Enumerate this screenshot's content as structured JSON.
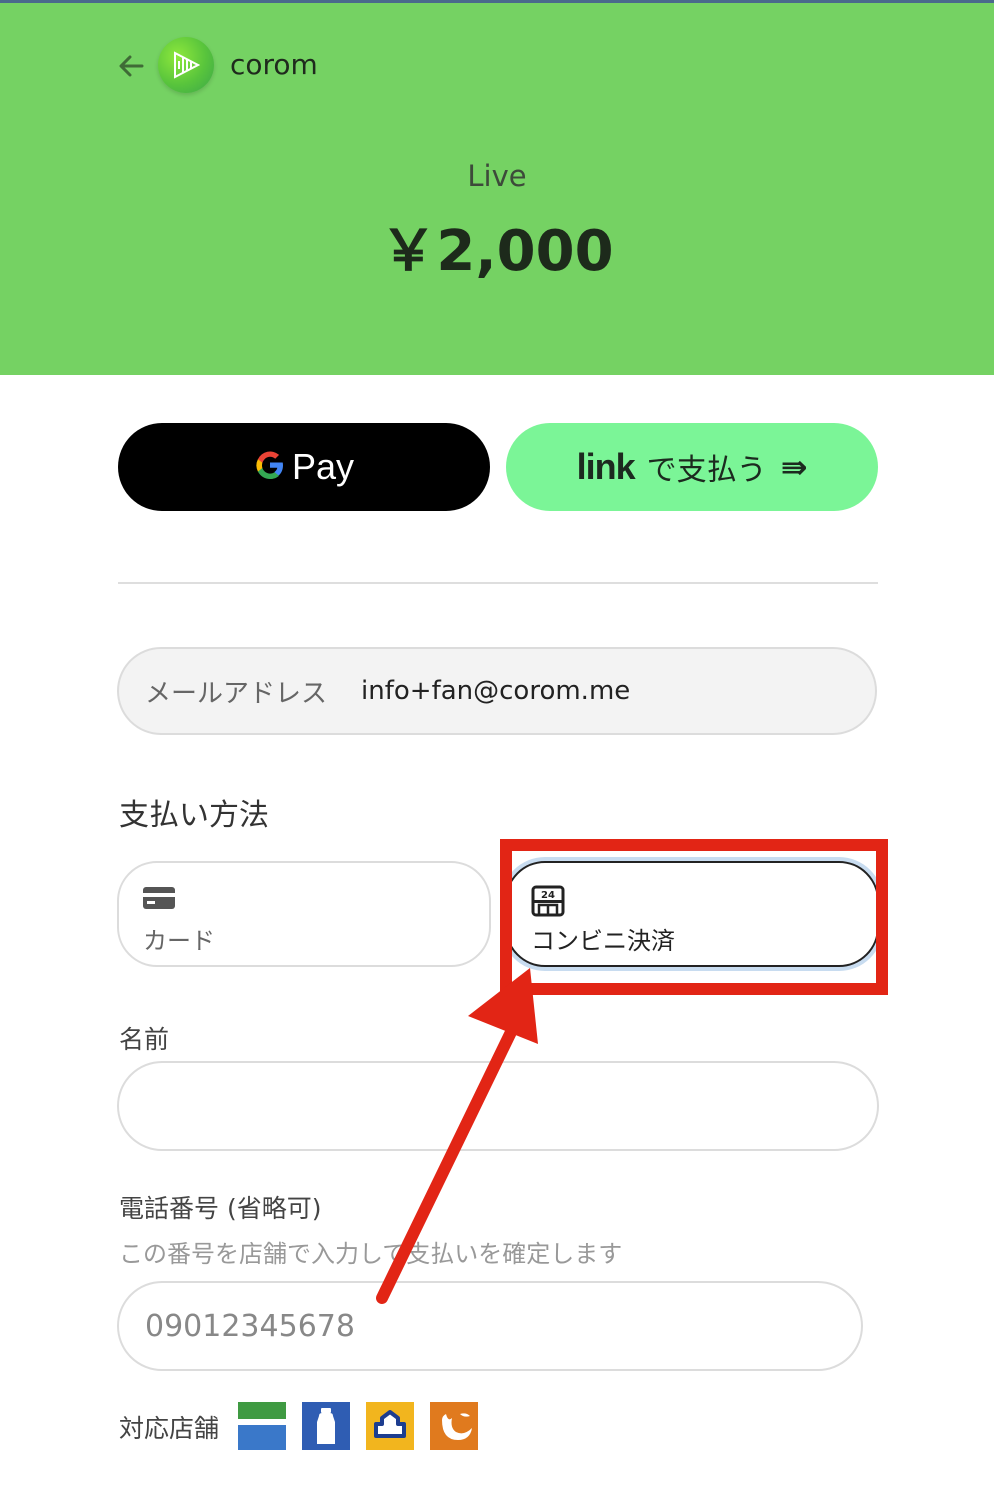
{
  "header": {
    "merchant_name": "corom",
    "mode": "Live",
    "amount": "￥2,000",
    "background": "#75d263"
  },
  "express": {
    "gpay_label": "Pay",
    "link_word": "link",
    "link_label": "で支払う",
    "link_arrow": "⇛",
    "link_color": "#7bf597"
  },
  "email": {
    "label": "メールアドレス",
    "value": "info+fan@corom.me"
  },
  "payment_method": {
    "title": "支払い方法",
    "options": [
      {
        "label": "カード",
        "icon": "credit-card-icon",
        "selected": false
      },
      {
        "label": "コンビニ決済",
        "icon": "convenience-store-icon",
        "selected": true
      }
    ]
  },
  "form": {
    "name_label": "名前",
    "phone_label": "電話番号 (省略可)",
    "phone_hint": "この番号を店舗で入力して支払いを確定します",
    "phone_placeholder": "09012345678"
  },
  "stores": {
    "label": "対応店舗",
    "logos": [
      "familymart-logo-icon",
      "ministop-logo-icon",
      "lawson-logo-icon",
      "seicomart-logo-icon"
    ]
  },
  "annotation": {
    "color": "#e22515"
  }
}
